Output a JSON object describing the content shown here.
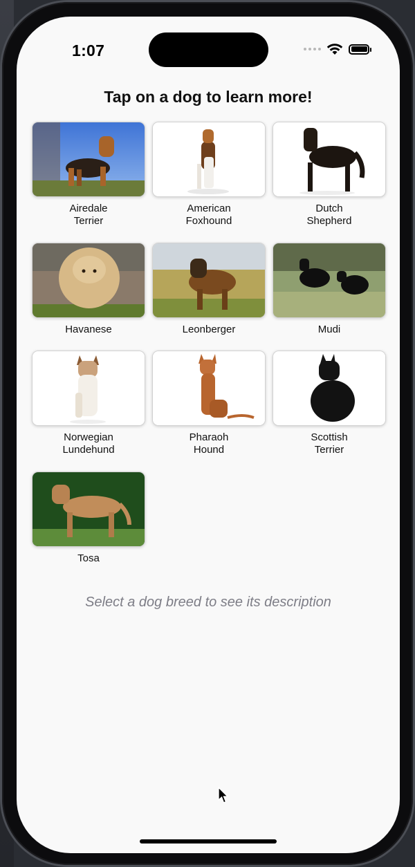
{
  "status_bar": {
    "time": "1:07",
    "icons": [
      "cellular-signal-icon",
      "wifi-icon",
      "battery-icon"
    ]
  },
  "header": {
    "title": "Tap on a dog to learn more!"
  },
  "breeds": [
    {
      "name": "Airedale\nTerrier"
    },
    {
      "name": "American\nFoxhound"
    },
    {
      "name": "Dutch\nShepherd"
    },
    {
      "name": "Havanese"
    },
    {
      "name": "Leonberger"
    },
    {
      "name": "Mudi"
    },
    {
      "name": "Norwegian\nLundehund"
    },
    {
      "name": "Pharaoh\nHound"
    },
    {
      "name": "Scottish\nTerrier"
    },
    {
      "name": "Tosa"
    }
  ],
  "description": {
    "placeholder": "Select a dog breed to see its description"
  },
  "colors": {
    "screen_background": "#f9f9f9",
    "hint_text": "#7d7d86",
    "title_text": "#111111"
  }
}
